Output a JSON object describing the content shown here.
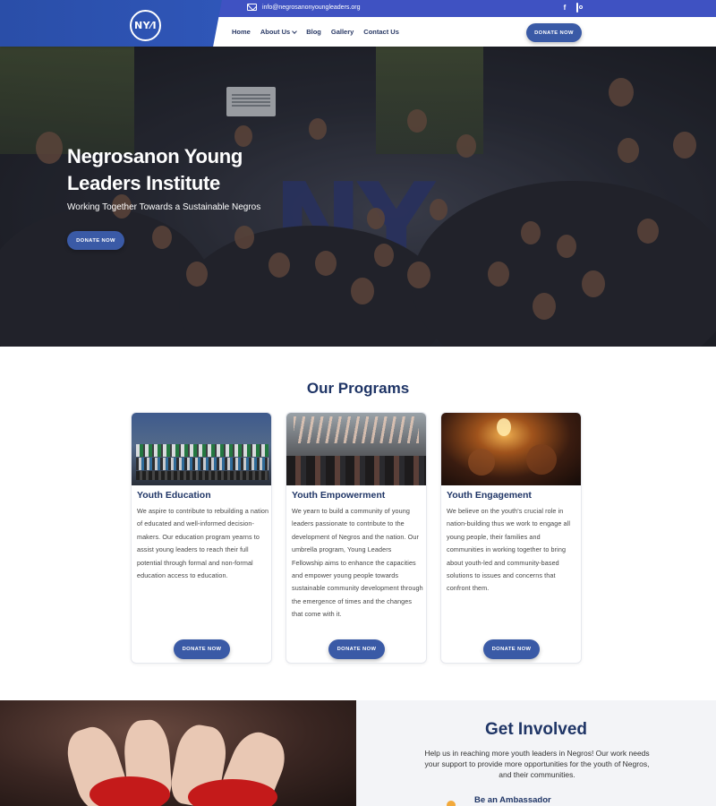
{
  "header": {
    "logo_text": "NY⁄I",
    "email": "info@negrosanonyoungleaders.org",
    "social": {
      "facebook_icon": "f",
      "instagram_icon": "instagram-icon"
    },
    "nav": [
      {
        "label": "Home"
      },
      {
        "label": "About Us",
        "has_dropdown": true
      },
      {
        "label": "Blog"
      },
      {
        "label": "Gallery"
      },
      {
        "label": "Contact Us"
      }
    ],
    "donate_label": "DONATE NOW"
  },
  "hero": {
    "title": "Negrosanon Young Leaders Institute",
    "subtitle": "Working Together Towards a Sustainable Negros",
    "button_label": "DONATE NOW"
  },
  "programs": {
    "title": "Our Programs",
    "cards": [
      {
        "title": "Youth Education",
        "text": "We aspire to contribute to rebuilding a nation of educated and well-informed decision-makers. Our education program yearns to assist young leaders to reach their full potential through formal and non-formal education access to education.",
        "button_label": "DONATE NOW"
      },
      {
        "title": "Youth Empowerment",
        "text": "We yearn to build a community of young leaders passionate to contribute to the development of Negros and the nation. Our umbrella program, Young Leaders Fellowship aims to enhance the capacities and empower young people towards sustainable community development through the emergence of times and the changes that come with it.",
        "button_label": "DONATE NOW"
      },
      {
        "title": "Youth Engagement",
        "text": "We believe on the youth's crucial role in nation-building thus we work to engage all young people, their families and communities in working together to bring about youth-led and community-based solutions to issues and concerns that confront them.",
        "button_label": "DONATE NOW"
      }
    ]
  },
  "get_involved": {
    "title": "Get Involved",
    "text": "Help us in reaching more youth leaders in Negros! Our work needs your support to provide more opportunities for the youth of Negros, and their communities.",
    "items": [
      {
        "title": "Be an Ambassador"
      }
    ]
  },
  "colors": {
    "brand_blue": "#2f56b8",
    "topbar_blue": "#3f52c2",
    "button_blue": "#3a5aa6",
    "heading_navy": "#1f3566",
    "accent_orange": "#f2a93b"
  }
}
